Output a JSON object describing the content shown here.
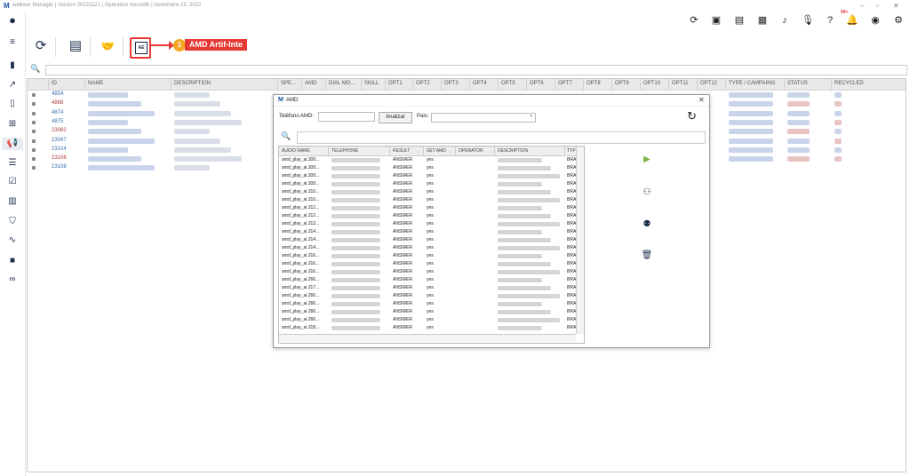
{
  "app": {
    "title": "welkeer Manager | Version 20221121 | Operation microdlb | noviembre 23, 2022",
    "notif_badge": "99+"
  },
  "window_controls": [
    "–",
    "▫",
    "✕"
  ],
  "top_icons": [
    "refresh-icon",
    "briefcase-icon",
    "book-icon",
    "contact-card-icon",
    "music-note-icon",
    "microphone-icon",
    "help-icon",
    "bell-icon",
    "user-icon",
    "gear-icon"
  ],
  "callout": {
    "number": "1",
    "label": "AMD Artif-Inte"
  },
  "amd_button_text": "AE",
  "table": {
    "headers": [
      "ID",
      "NAME",
      "DESCRIPTION",
      "SPE...",
      "AMD",
      "DIAL MO...",
      "SKILL",
      "OPT1",
      "OPT2",
      "OPT3",
      "OPT4",
      "OPT5",
      "OPT6",
      "OPT7",
      "OPT8",
      "OPT9",
      "OPT10",
      "OPT11",
      "OPT12",
      "TYPE / CAMPAING",
      "STATUS",
      "RECYCLED"
    ],
    "rows": [
      {
        "id": "4854",
        "color": "#3a6fb0"
      },
      {
        "id": "4868",
        "color": "#b03a3a"
      },
      {
        "id": "4874",
        "color": "#3a6fb0"
      },
      {
        "id": "4875",
        "color": "#3a6fb0"
      },
      {
        "id": "23082",
        "color": "#b03a3a"
      },
      {
        "id": "23087",
        "color": "#3a6fb0"
      },
      {
        "id": "23104",
        "color": "#3a6fb0"
      },
      {
        "id": "23106",
        "color": "#b03a3a"
      },
      {
        "id": "23108",
        "color": "#3a6fb0"
      }
    ]
  },
  "dialog": {
    "logo": "M",
    "title": "AMD",
    "close": "✕",
    "phone_label": "Teléfono AMD:",
    "analyze_label": "Analizar",
    "country_label": "Pais:",
    "columns": [
      "AUDIO NAME",
      "TELEPHONE",
      "RESULT",
      "SET AMD",
      "OPERATOR",
      "DESCRIPTION",
      "TYP"
    ],
    "rows": [
      {
        "audio": "amd_play_ai.309...",
        "result": "ANSWER",
        "set": "yes",
        "typ": "BRA"
      },
      {
        "audio": "amd_play_ai.309...",
        "result": "ANSWER",
        "set": "yes",
        "typ": "BRA"
      },
      {
        "audio": "amd_play_ai.309...",
        "result": "ANSWER",
        "set": "yes",
        "typ": "BRA"
      },
      {
        "audio": "amd_play_ai.309...",
        "result": "ANSWER",
        "set": "yes",
        "typ": "BRA"
      },
      {
        "audio": "amd_play_ai.310...",
        "result": "ANSWER",
        "set": "yes",
        "typ": "BRA"
      },
      {
        "audio": "amd_play_ai.310...",
        "result": "ANSWER",
        "set": "yes",
        "typ": "BRA"
      },
      {
        "audio": "amd_play_ai.312...",
        "result": "ANSWER",
        "set": "yes",
        "typ": "BRA"
      },
      {
        "audio": "amd_play_ai.312...",
        "result": "ANSWER",
        "set": "yes",
        "typ": "BRA"
      },
      {
        "audio": "amd_play_ai.313...",
        "result": "ANSWER",
        "set": "yes",
        "typ": "BRA"
      },
      {
        "audio": "amd_play_ai.314...",
        "result": "ANSWER",
        "set": "yes",
        "typ": "BRA"
      },
      {
        "audio": "amd_play_ai.314...",
        "result": "ANSWER",
        "set": "yes",
        "typ": "BRA"
      },
      {
        "audio": "amd_play_ai.314...",
        "result": "ANSWER",
        "set": "yes",
        "typ": "BRA"
      },
      {
        "audio": "amd_play_ai.316...",
        "result": "ANSWER",
        "set": "yes",
        "typ": "BRA"
      },
      {
        "audio": "amd_play_ai.316...",
        "result": "ANSWER",
        "set": "yes",
        "typ": "BRA"
      },
      {
        "audio": "amd_play_ai.316...",
        "result": "ANSWER",
        "set": "yes",
        "typ": "BRA"
      },
      {
        "audio": "amd_play_ai.266...",
        "result": "ANSWER",
        "set": "yes",
        "typ": "BRA"
      },
      {
        "audio": "amd_play_ai.317...",
        "result": "ANSWER",
        "set": "yes",
        "typ": "BRA"
      },
      {
        "audio": "amd_play_ai.266...",
        "result": "ANSWER",
        "set": "yes",
        "typ": "BRA"
      },
      {
        "audio": "amd_play_ai.266...",
        "result": "ANSWER",
        "set": "yes",
        "typ": "BRA"
      },
      {
        "audio": "amd_play_ai.266...",
        "result": "ANSWER",
        "set": "yes",
        "typ": "BRA"
      },
      {
        "audio": "amd_play_ai.266...",
        "result": "ANSWER",
        "set": "yes",
        "typ": "BRA"
      },
      {
        "audio": "amd_play_ai.318...",
        "result": "ANSWER",
        "set": "yes",
        "typ": "BRA"
      }
    ]
  },
  "colors": {
    "accent_red": "#e53935",
    "callout_orange": "#f5a623",
    "play_green": "#7cb342"
  }
}
